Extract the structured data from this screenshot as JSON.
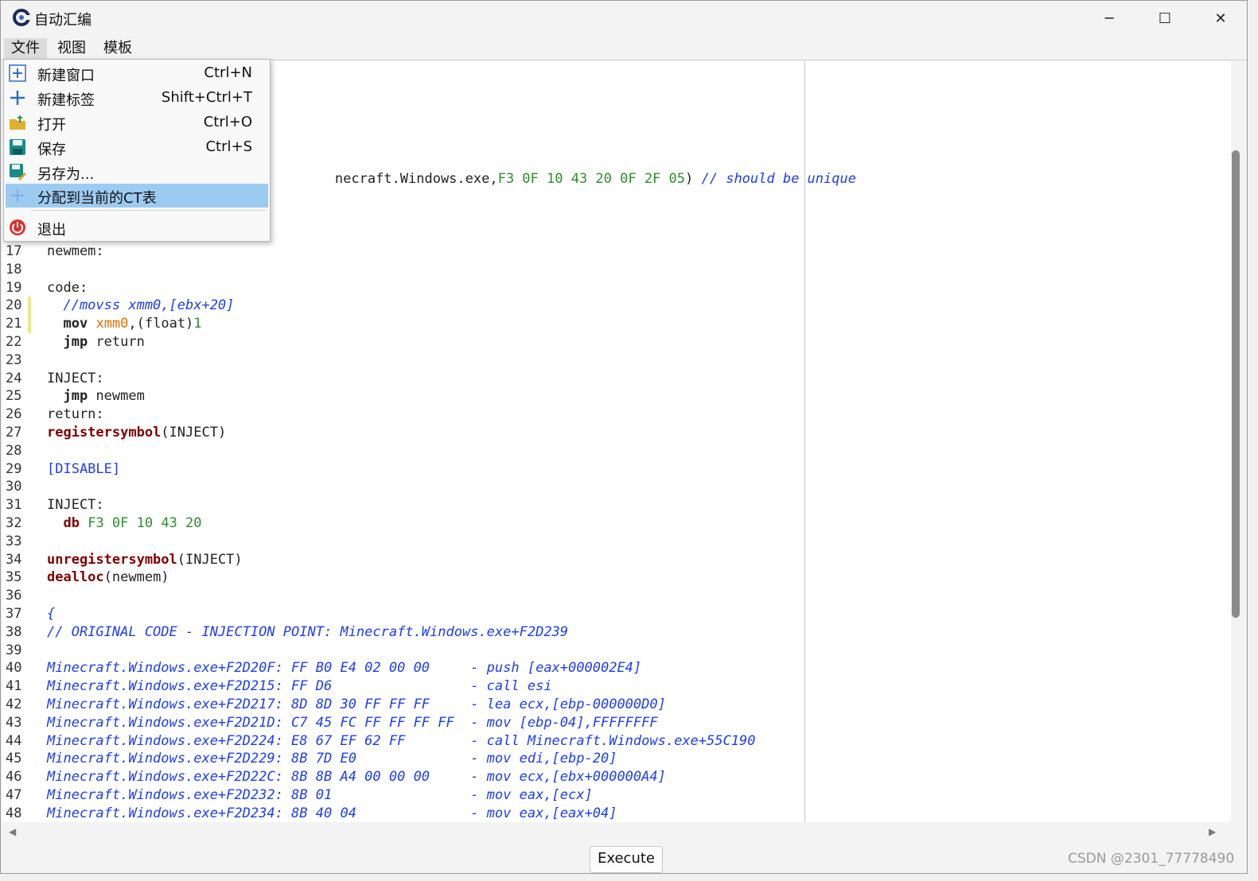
{
  "window": {
    "title": "自动汇编",
    "minimize_glyph": "─",
    "maximize_glyph": "☐",
    "close_glyph": "✕"
  },
  "menubar": [
    {
      "label": "文件"
    },
    {
      "label": "视图"
    },
    {
      "label": "模板"
    }
  ],
  "file_menu": [
    {
      "label": "新建窗口",
      "shortcut": "Ctrl+N",
      "icon": "new-window-icon"
    },
    {
      "label": "新建标签",
      "shortcut": "Shift+Ctrl+T",
      "icon": "new-tab-icon"
    },
    {
      "label": "打开",
      "shortcut": "Ctrl+O",
      "icon": "open-folder-icon"
    },
    {
      "label": "保存",
      "shortcut": "Ctrl+S",
      "icon": "save-disk-icon"
    },
    {
      "label": "另存为...",
      "shortcut": "",
      "icon": "save-as-icon"
    },
    {
      "label": "分配到当前的CT表",
      "shortcut": "",
      "icon": "assign-plus-icon",
      "highlighted": true
    },
    {
      "label": "退出",
      "shortcut": "",
      "icon": "power-icon"
    }
  ],
  "editor": {
    "partial_line_text": "necraft.Windows.exe,",
    "partial_line_hex": "F3 0F 10 43 20 0F 2F 05",
    "partial_line_close": ")",
    "partial_line_comment": "// should be unique",
    "lines": [
      {
        "n": "17",
        "segs": [
          {
            "t": "newmem:",
            "c": ""
          }
        ]
      },
      {
        "n": "18",
        "segs": []
      },
      {
        "n": "19",
        "segs": [
          {
            "t": "code:",
            "c": ""
          }
        ]
      },
      {
        "n": "20",
        "segs": [
          {
            "t": "  //movss xmm0,[ebx+20]",
            "c": "cm"
          }
        ]
      },
      {
        "n": "21",
        "segs": [
          {
            "t": "  ",
            "c": ""
          },
          {
            "t": "mov",
            "c": "kw2"
          },
          {
            "t": " ",
            "c": ""
          },
          {
            "t": "xmm0",
            "c": "reg"
          },
          {
            "t": ",(float)",
            "c": ""
          },
          {
            "t": "1",
            "c": "hex"
          }
        ]
      },
      {
        "n": "22",
        "segs": [
          {
            "t": "  ",
            "c": ""
          },
          {
            "t": "jmp",
            "c": "kw2"
          },
          {
            "t": " return",
            "c": ""
          }
        ]
      },
      {
        "n": "23",
        "segs": []
      },
      {
        "n": "24",
        "segs": [
          {
            "t": "INJECT:",
            "c": ""
          }
        ]
      },
      {
        "n": "25",
        "segs": [
          {
            "t": "  ",
            "c": ""
          },
          {
            "t": "jmp",
            "c": "kw2"
          },
          {
            "t": " newmem",
            "c": ""
          }
        ]
      },
      {
        "n": "26",
        "segs": [
          {
            "t": "return:",
            "c": ""
          }
        ]
      },
      {
        "n": "27",
        "segs": [
          {
            "t": "registersymbol",
            "c": "kw"
          },
          {
            "t": "(INJECT)",
            "c": ""
          }
        ]
      },
      {
        "n": "28",
        "segs": []
      },
      {
        "n": "29",
        "segs": [
          {
            "t": "[DISABLE]",
            "c": "sec"
          }
        ]
      },
      {
        "n": "30",
        "segs": []
      },
      {
        "n": "31",
        "segs": [
          {
            "t": "INJECT:",
            "c": ""
          }
        ]
      },
      {
        "n": "32",
        "segs": [
          {
            "t": "  ",
            "c": ""
          },
          {
            "t": "db",
            "c": "kw"
          },
          {
            "t": " ",
            "c": ""
          },
          {
            "t": "F3 0F 10 43 20",
            "c": "hex"
          }
        ]
      },
      {
        "n": "33",
        "segs": []
      },
      {
        "n": "34",
        "segs": [
          {
            "t": "unregistersymbol",
            "c": "kw"
          },
          {
            "t": "(INJECT)",
            "c": ""
          }
        ]
      },
      {
        "n": "35",
        "segs": [
          {
            "t": "dealloc",
            "c": "kw"
          },
          {
            "t": "(newmem)",
            "c": ""
          }
        ]
      },
      {
        "n": "36",
        "segs": []
      },
      {
        "n": "37",
        "segs": [
          {
            "t": "{",
            "c": "cm"
          }
        ]
      },
      {
        "n": "38",
        "segs": [
          {
            "t": "// ORIGINAL CODE - INJECTION POINT: Minecraft.Windows.exe+F2D239",
            "c": "cm"
          }
        ]
      },
      {
        "n": "39",
        "segs": []
      },
      {
        "n": "40",
        "segs": [
          {
            "t": "Minecraft.Windows.exe+F2D20F: FF B0 E4 02 00 00     - push [eax+000002E4]",
            "c": "cm"
          }
        ]
      },
      {
        "n": "41",
        "segs": [
          {
            "t": "Minecraft.Windows.exe+F2D215: FF D6                 - call esi",
            "c": "cm"
          }
        ]
      },
      {
        "n": "42",
        "segs": [
          {
            "t": "Minecraft.Windows.exe+F2D217: 8D 8D 30 FF FF FF     - lea ecx,[ebp-000000D0]",
            "c": "cm"
          }
        ]
      },
      {
        "n": "43",
        "segs": [
          {
            "t": "Minecraft.Windows.exe+F2D21D: C7 45 FC FF FF FF FF  - mov [ebp-04],FFFFFFFF",
            "c": "cm"
          }
        ]
      },
      {
        "n": "44",
        "segs": [
          {
            "t": "Minecraft.Windows.exe+F2D224: E8 67 EF 62 FF        - call Minecraft.Windows.exe+55C190",
            "c": "cm"
          }
        ]
      },
      {
        "n": "45",
        "segs": [
          {
            "t": "Minecraft.Windows.exe+F2D229: 8B 7D E0              - mov edi,[ebp-20]",
            "c": "cm"
          }
        ]
      },
      {
        "n": "46",
        "segs": [
          {
            "t": "Minecraft.Windows.exe+F2D22C: 8B 8B A4 00 00 00     - mov ecx,[ebx+000000A4]",
            "c": "cm"
          }
        ]
      },
      {
        "n": "47",
        "segs": [
          {
            "t": "Minecraft.Windows.exe+F2D232: 8B 01                 - mov eax,[ecx]",
            "c": "cm"
          }
        ]
      },
      {
        "n": "48",
        "segs": [
          {
            "t": "Minecraft.Windows.exe+F2D234: 8B 40 04              - mov eax,[eax+04]",
            "c": "cm"
          }
        ]
      }
    ]
  },
  "execute_button": "Execute",
  "watermark": "CSDN @2301_77778490"
}
